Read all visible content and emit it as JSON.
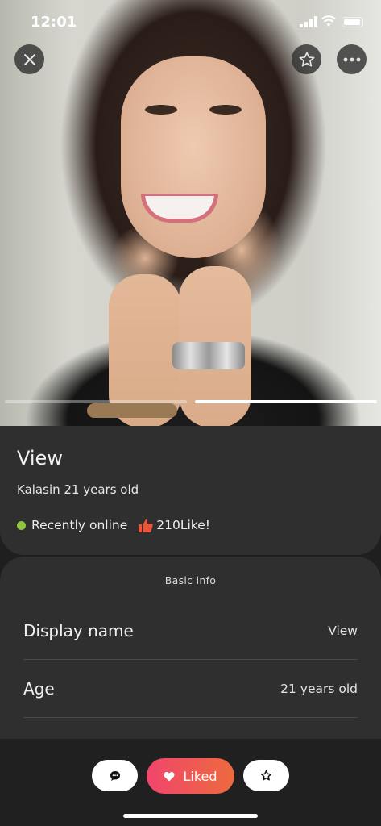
{
  "status_bar": {
    "time": "12:01"
  },
  "photo": {
    "active_index": 2,
    "count": 2
  },
  "profile": {
    "name": "View",
    "subtitle": "Kalasin 21 years old",
    "online_status": "Recently online",
    "likes": "210Like!"
  },
  "basic_info": {
    "title": "Basic info",
    "rows": [
      {
        "label": "Display name",
        "value": "View"
      },
      {
        "label": "Age",
        "value": "21 years old"
      }
    ]
  },
  "actions": {
    "liked_label": "Liked"
  },
  "colors": {
    "online": "#8fc53f",
    "like_thumb": "#e8553a",
    "liked_start": "#f0456c",
    "liked_end": "#ee6a3e"
  },
  "icons": [
    "close-icon",
    "star-icon",
    "more-icon",
    "thumbs-up-icon",
    "chat-icon",
    "heart-icon",
    "star-outline-icon"
  ]
}
